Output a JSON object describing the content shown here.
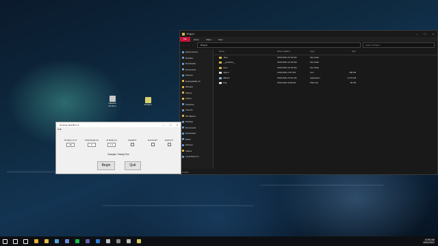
{
  "desktop": {
    "icons": [
      {
        "label": "UEIstick Desktop",
        "color": "#c8c8c8"
      },
      {
        "label": "JProject",
        "color": "#d8d070"
      }
    ]
  },
  "explorer": {
    "title": "JProject",
    "ribbon_tabs": [
      "File",
      "Home",
      "Share",
      "View"
    ],
    "address": "JProject",
    "search_placeholder": "Search JProject",
    "nav_items": [
      {
        "label": "Quick access",
        "icon": "star-icon"
      },
      {
        "label": "Desktop",
        "icon": "desktop-icon"
      },
      {
        "label": "Downloads",
        "icon": "download-icon"
      },
      {
        "label": "Documents",
        "icon": "documents-icon"
      },
      {
        "label": "Pictures",
        "icon": "pictures-icon"
      },
      {
        "label": "Employability Ja",
        "icon": "folder-icon"
      },
      {
        "label": "JProject",
        "icon": "folder-icon"
      },
      {
        "label": "Videos",
        "icon": "folder-icon"
      },
      {
        "label": "Voices",
        "icon": "folder-icon"
      },
      {
        "label": "OneDrive",
        "icon": "cloud-icon"
      },
      {
        "label": "This PC",
        "icon": "pc-icon"
      },
      {
        "label": "3D Objects",
        "icon": "folder-icon"
      },
      {
        "label": "Desktop",
        "icon": "desktop-icon"
      },
      {
        "label": "Documents",
        "icon": "documents-icon"
      },
      {
        "label": "Downloads",
        "icon": "download-icon"
      },
      {
        "label": "Music",
        "icon": "music-icon"
      },
      {
        "label": "Pictures",
        "icon": "pictures-icon"
      },
      {
        "label": "Videos",
        "icon": "folder-icon"
      },
      {
        "label": "Local Disk (C:)",
        "icon": "drive-icon"
      }
    ],
    "columns": [
      "Name",
      "Date modified",
      "Type",
      "Size"
    ],
    "files": [
      {
        "name": ".idea",
        "date": "15/01/2021 10:40 AM",
        "type": "File folder",
        "size": "",
        "kind": "folder"
      },
      {
        "name": "__pycache__",
        "date": "15/01/2021 10:40 AM",
        "type": "File folder",
        "size": "",
        "kind": "folder"
      },
      {
        "name": "venv",
        "date": "15/01/2021 10:40 AM",
        "type": "File folder",
        "size": "",
        "kind": "folder"
      },
      {
        "name": "Jspico",
        "date": "14/01/2021 4:57 PM",
        "type": "Icon",
        "size": "158 KB",
        "kind": "icon"
      },
      {
        "name": "UBotv1",
        "date": "15/01/2021 10:51 AM",
        "type": "Application",
        "size": "9,719 KB",
        "kind": "app"
      },
      {
        "name": "Png",
        "date": "15/01/2021 8:38 AM",
        "type": "PNG File",
        "size": "82 KB",
        "kind": "png"
      }
    ],
    "status": "6 items"
  },
  "dialog": {
    "title": "Jumping Jack Bot! v1",
    "menu": "Help",
    "fields": [
      {
        "label": "Number of JJ",
        "kind": "input",
        "value": "58"
      },
      {
        "label": "Initial Delay (s)",
        "kind": "input",
        "value": "5"
      },
      {
        "label": "JJ Delay (s)",
        "kind": "input",
        "value": "1.4"
      },
      {
        "label": "Capitals?",
        "kind": "checkbox"
      },
      {
        "label": "Grammar?",
        "kind": "checkbox"
      },
      {
        "label": "Hyphen?",
        "kind": "checkbox"
      }
    ],
    "example": "Example: Twenty Five",
    "begin_label": "Begin",
    "quit_label": "Quit"
  },
  "taskbar": {
    "icons": [
      {
        "name": "start-icon",
        "color": "#ffffff"
      },
      {
        "name": "search-icon",
        "color": "#ffffff"
      },
      {
        "name": "task-view-icon",
        "color": "#ffffff"
      },
      {
        "name": "chrome-icon",
        "color": "#e8b13a"
      },
      {
        "name": "explorer-icon",
        "color": "#e0c050"
      },
      {
        "name": "store-icon",
        "color": "#4fa3e0"
      },
      {
        "name": "discord-icon",
        "color": "#7289da"
      },
      {
        "name": "spotify-icon",
        "color": "#1db954"
      },
      {
        "name": "teams-icon",
        "color": "#6264a7"
      },
      {
        "name": "mail-icon",
        "color": "#2b7cd3"
      },
      {
        "name": "steam-icon",
        "color": "#c0c0c0"
      },
      {
        "name": "terminal-icon",
        "color": "#888888"
      },
      {
        "name": "clock-app-icon",
        "color": "#bbbbbb"
      },
      {
        "name": "python-icon",
        "color": "#d6c75a"
      }
    ],
    "time": "10:55 AM",
    "date": "15/01/2021"
  }
}
